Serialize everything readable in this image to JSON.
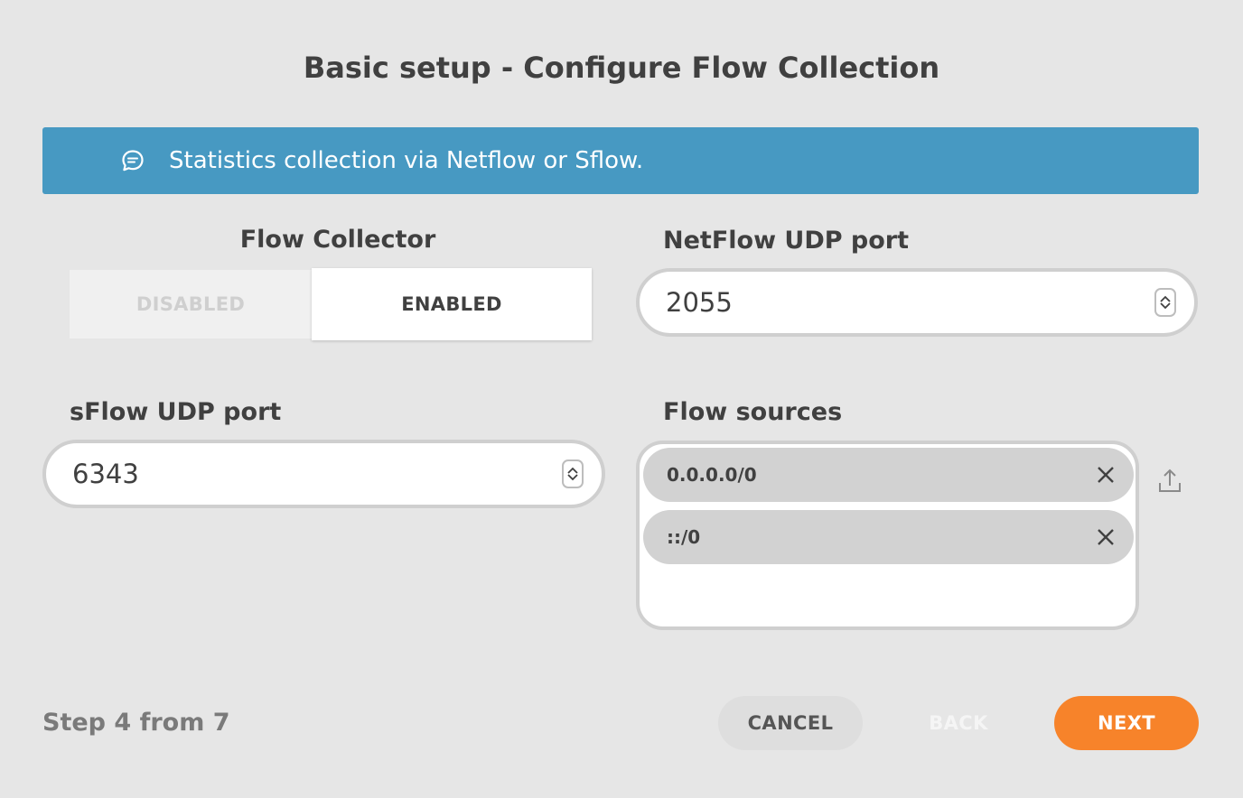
{
  "title": "Basic setup - Configure Flow Collection",
  "banner": {
    "icon": "chat-bubble-icon",
    "text": "Statistics collection via Netflow or Sflow.",
    "color": "#4799c2"
  },
  "flow_collector": {
    "label": "Flow Collector",
    "options": [
      "DISABLED",
      "ENABLED"
    ],
    "selected": "ENABLED"
  },
  "netflow": {
    "label": "NetFlow UDP port",
    "value": "2055"
  },
  "sflow": {
    "label": "sFlow UDP port",
    "value": "6343"
  },
  "flow_sources": {
    "label": "Flow sources",
    "items": [
      "0.0.0.0/0",
      "::/0"
    ]
  },
  "footer": {
    "step_text": "Step 4 from 7",
    "cancel_label": "CANCEL",
    "back_label": "BACK",
    "next_label": "NEXT",
    "next_color": "#f7832a"
  }
}
